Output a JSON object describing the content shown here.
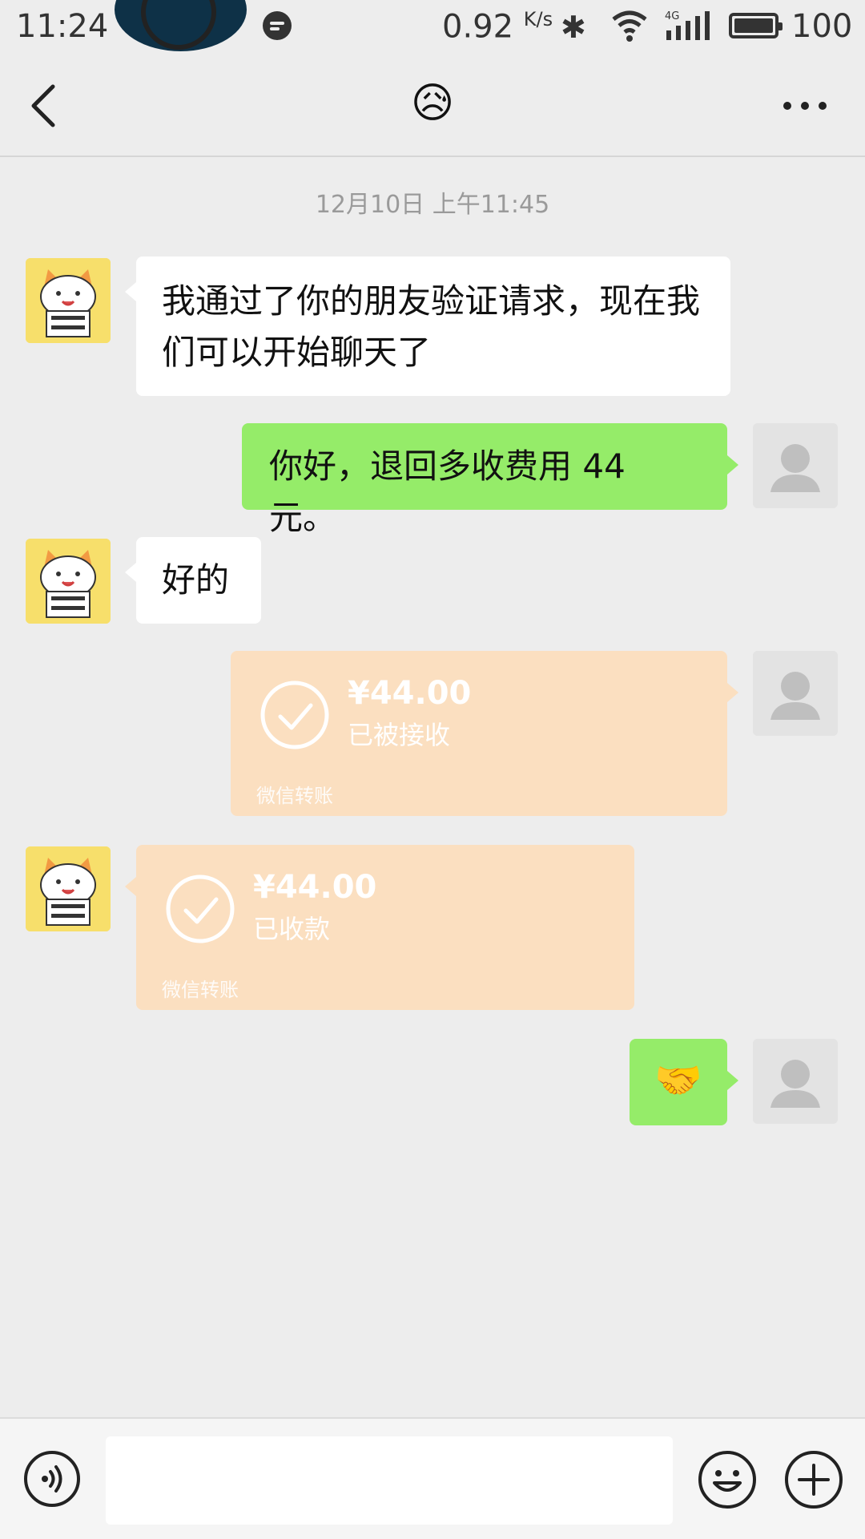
{
  "status_bar": {
    "time": "11:24",
    "net_speed": "0.92",
    "net_unit": "K/s",
    "network": "4G",
    "battery": "100"
  },
  "header": {
    "title_emoji": "😥",
    "back_icon": "chevron-left-icon",
    "more_icon": "more-dots-icon"
  },
  "chat": {
    "timestamp": "12月10日 上午11:45",
    "messages": [
      {
        "from": "contact",
        "type": "text",
        "text": "我通过了你的朋友验证请求，现在我们可以开始聊天了"
      },
      {
        "from": "me",
        "type": "text",
        "text": "你好，退回多收费用 44 元。"
      },
      {
        "from": "contact",
        "type": "text",
        "text": "好的"
      },
      {
        "from": "me",
        "type": "transfer",
        "amount": "¥44.00",
        "status": "已被接收",
        "label": "微信转账"
      },
      {
        "from": "contact",
        "type": "transfer",
        "amount": "¥44.00",
        "status": "已收款",
        "label": "微信转账"
      },
      {
        "from": "me",
        "type": "emoji",
        "text": "🤝"
      }
    ]
  },
  "input_bar": {
    "placeholder": "",
    "voice_icon": "voice-icon",
    "emoji_icon": "emoji-icon",
    "plus_icon": "plus-icon"
  },
  "colors": {
    "background": "#ededed",
    "sent_bubble": "#95ec69",
    "received_bubble": "#ffffff",
    "transfer_bubble": "#fbdfc0",
    "timestamp": "#9a9a9a"
  }
}
